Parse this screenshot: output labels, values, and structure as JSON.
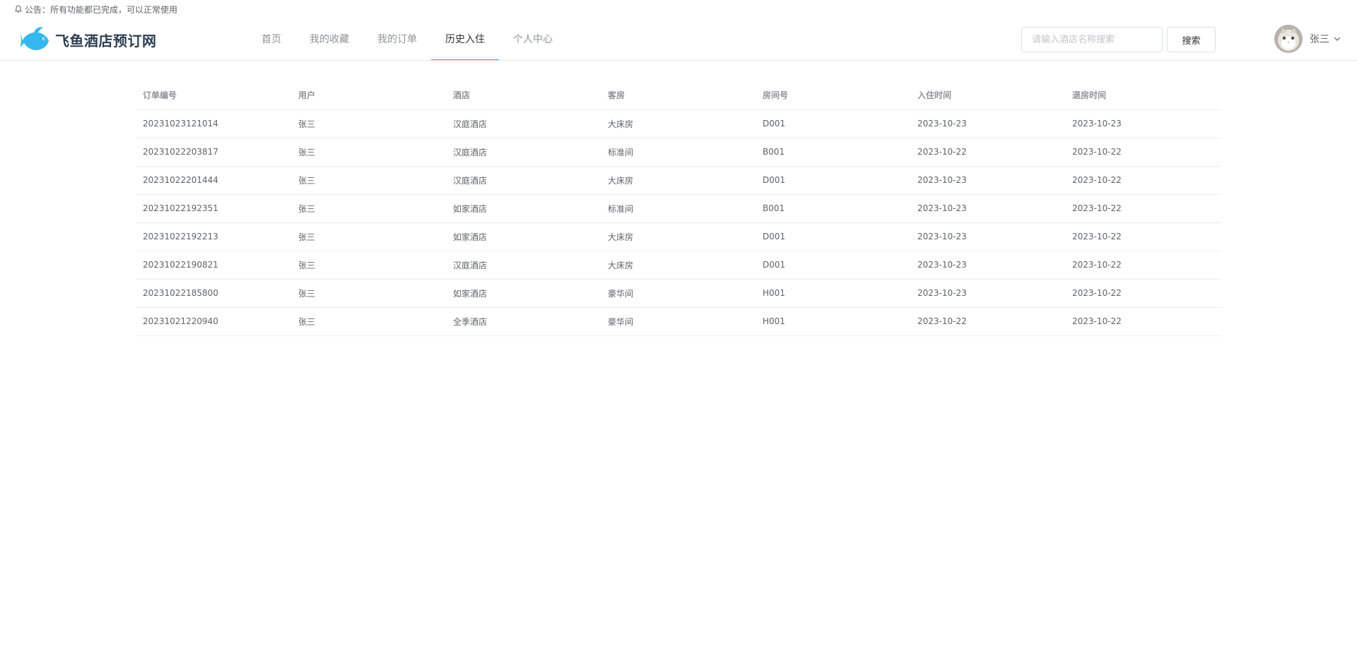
{
  "notice": {
    "text": "公告：所有功能都已完成，可以正常使用"
  },
  "header": {
    "brand": "飞鱼酒店预订网",
    "nav": [
      {
        "label": "首页",
        "active": false
      },
      {
        "label": "我的收藏",
        "active": false
      },
      {
        "label": "我的订单",
        "active": false
      },
      {
        "label": "历史入住",
        "active": true
      },
      {
        "label": "个人中心",
        "active": false
      }
    ],
    "search": {
      "placeholder": "请输入酒店名称搜索",
      "value": "",
      "button_label": "搜索"
    },
    "user": {
      "name": "张三"
    }
  },
  "colors": {
    "accent": "#409eff",
    "brand_text": "#2c3e50",
    "fish": "#35b8ee"
  },
  "table": {
    "columns": [
      "订单编号",
      "用户",
      "酒店",
      "客房",
      "房间号",
      "入住时间",
      "退房时间"
    ],
    "rows": [
      [
        "20231023121014",
        "张三",
        "汉庭酒店",
        "大床房",
        "D001",
        "2023-10-23",
        "2023-10-23"
      ],
      [
        "20231022203817",
        "张三",
        "汉庭酒店",
        "标准间",
        "B001",
        "2023-10-22",
        "2023-10-22"
      ],
      [
        "20231022201444",
        "张三",
        "汉庭酒店",
        "大床房",
        "D001",
        "2023-10-23",
        "2023-10-22"
      ],
      [
        "20231022192351",
        "张三",
        "如家酒店",
        "标准间",
        "B001",
        "2023-10-23",
        "2023-10-22"
      ],
      [
        "20231022192213",
        "张三",
        "如家酒店",
        "大床房",
        "D001",
        "2023-10-23",
        "2023-10-22"
      ],
      [
        "20231022190821",
        "张三",
        "汉庭酒店",
        "大床房",
        "D001",
        "2023-10-23",
        "2023-10-22"
      ],
      [
        "20231022185800",
        "张三",
        "如家酒店",
        "豪华间",
        "H001",
        "2023-10-23",
        "2023-10-22"
      ],
      [
        "20231021220940",
        "张三",
        "全季酒店",
        "豪华间",
        "H001",
        "2023-10-22",
        "2023-10-22"
      ]
    ]
  }
}
